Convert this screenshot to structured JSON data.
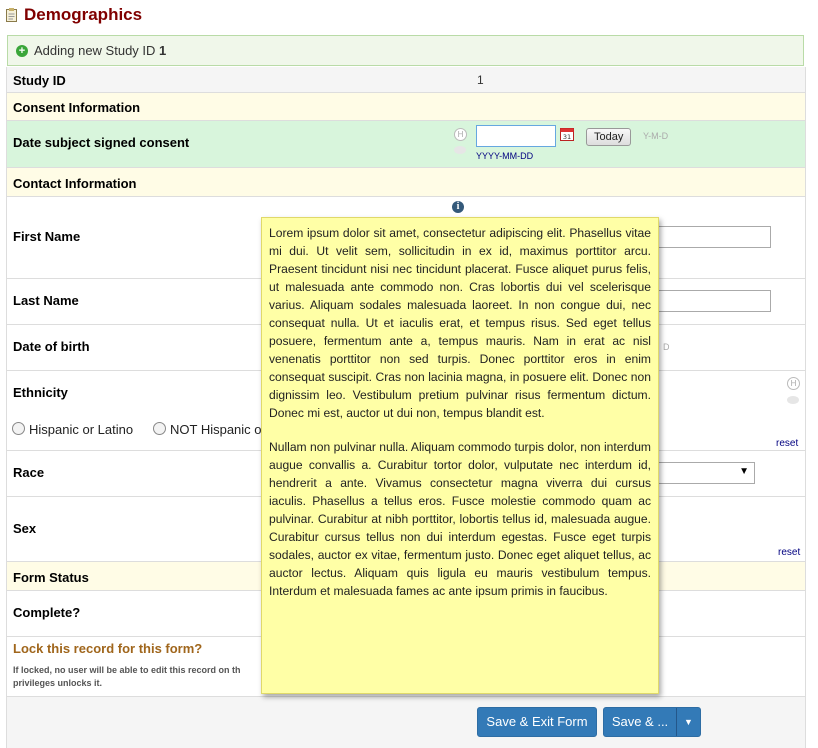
{
  "page": {
    "title": "Demographics"
  },
  "banner": {
    "prefix": "Adding new Study ID",
    "record_id": "1"
  },
  "study_id": {
    "label": "Study ID",
    "value": "1"
  },
  "sections": {
    "consent": "Consent Information",
    "contact": "Contact Information",
    "form_status": "Form Status"
  },
  "consent_date": {
    "label": "Date subject signed consent",
    "today_button": "Today",
    "format_hint": "Y-M-D",
    "format_below": "YYYY-MM-DD",
    "value": ""
  },
  "fields": {
    "first_name": "First Name",
    "last_name": "Last Name",
    "dob": "Date of birth",
    "dob_hint_fragment": "D",
    "ethnicity": "Ethnicity",
    "race": "Race",
    "sex": "Sex",
    "complete": "Complete?"
  },
  "ethnicity_options": [
    "Hispanic or Latino",
    "NOT Hispanic o"
  ],
  "reset_label": "reset",
  "lock": {
    "title": "Lock this record for this form?",
    "description": "If locked, no user will be able to edit this record on th privileges unlocks it."
  },
  "buttons": {
    "save_exit": "Save & Exit Form",
    "save_more": "Save & ..."
  },
  "note_popup": {
    "paragraphs": [
      "Lorem ipsum dolor sit amet, consectetur adipiscing elit. Phasellus vitae mi dui. Ut velit sem, sollicitudin in ex id, maximus porttitor arcu. Praesent tincidunt nisi nec tincidunt placerat. Fusce aliquet purus felis, ut malesuada ante commodo non. Cras lobortis dui vel scelerisque varius. Aliquam sodales malesuada laoreet. In non congue dui, nec consequat nulla. Ut et iaculis erat, et tempus risus. Sed eget tellus posuere, fermentum ante a, tempus mauris. Nam in erat ac nisl venenatis porttitor non sed turpis. Donec porttitor eros in enim consequat suscipit. Cras non lacinia magna, in posuere elit. Donec non dignissim leo. Vestibulum pretium pulvinar risus fermentum dictum. Donec mi est, auctor ut dui non, tempus blandit est.",
      "Nullam non pulvinar nulla. Aliquam commodo turpis dolor, non interdum augue convallis a. Curabitur tortor dolor, vulputate nec interdum id, hendrerit a ante. Vivamus consectetur magna viverra dui cursus iaculis. Phasellus a tellus eros. Fusce molestie commodo quam ac pulvinar. Curabitur at nibh porttitor, lobortis tellus id, malesuada augue. Curabitur cursus tellus non dui interdum egestas. Fusce eget turpis sodales, auctor ex vitae, fermentum justo. Donec eget aliquet tellus, ac auctor lectus. Aliquam quis ligula eu mauris vestibulum tempus. Interdum et malesuada fames ac ante ipsum primis in faucibus."
    ]
  },
  "icons": {
    "form": "form-icon",
    "add": "plus-circle-icon",
    "history": "history-h-icon",
    "comment": "comment-bubble-icon",
    "calendar": "calendar-icon",
    "info": "info-icon",
    "dropdown": "caret-down-icon"
  }
}
